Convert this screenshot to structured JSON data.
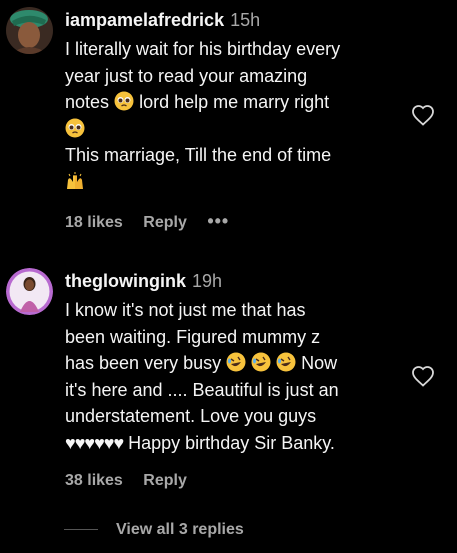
{
  "comments": [
    {
      "username": "iampamelafredrick",
      "time": "15h",
      "lines": [
        "I literally wait for his birthday every",
        "year just to read your amazing",
        "notes",
        "lord help me marry right",
        "This marriage, Till the end of time"
      ],
      "likes": "18 likes",
      "reply": "Reply",
      "more": "•••"
    },
    {
      "username": "theglowingink",
      "time": "19h",
      "lines": [
        "I know it's not just me that has",
        "been waiting. Figured mummy z",
        "has been very busy",
        "Now",
        "it's here and .... Beautiful is just an",
        "understatement. Love you guys",
        "♥♥♥♥♥♥",
        "Happy birthday Sir Banky."
      ],
      "likes": "38 likes",
      "reply": "Reply"
    }
  ],
  "view_replies": "View all 3 replies",
  "icons": {
    "heart": "heart-outline-icon",
    "pleading_face": "pleading-face-emoji",
    "raised_hands": "raising-hands-emoji",
    "rofl": "rolling-on-floor-laughing-emoji"
  },
  "colors": {
    "background": "#000000",
    "text": "#f5f5f5",
    "secondary": "#a8a8a8",
    "emoji_yellow": "#f7c23c"
  }
}
